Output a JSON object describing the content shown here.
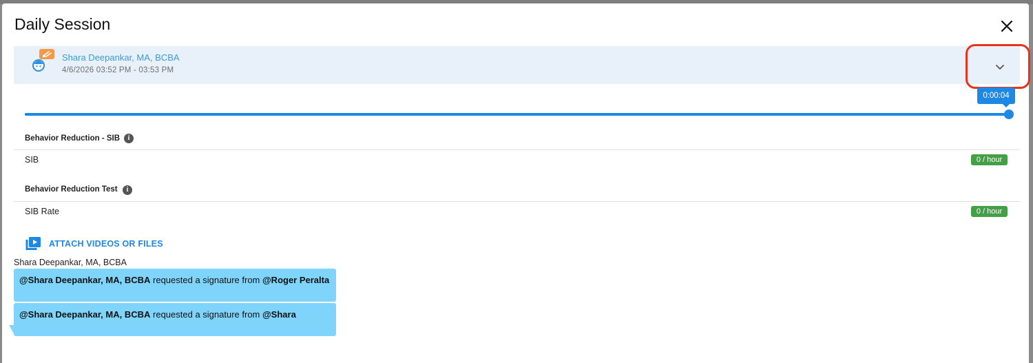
{
  "modal": {
    "title": "Daily Session"
  },
  "session": {
    "clinician": "Shara Deepankar, MA, BCBA",
    "time_range": "4/6/2026 03:52 PM - 03:53 PM"
  },
  "playback": {
    "current_time": "0:00:04",
    "progress": 1.0
  },
  "sections": [
    {
      "title": "Behavior Reduction - SIB",
      "row_label": "SIB",
      "rate": "0 / hour"
    },
    {
      "title": "Behavior Reduction Test",
      "row_label": "SIB Rate",
      "rate": "0 / hour"
    }
  ],
  "attach": {
    "label": "ATTACH VIDEOS OR FILES"
  },
  "comments": {
    "author": "Shara Deepankar, MA, BCBA",
    "messages": [
      {
        "requester": "@Shara Deepankar, MA, BCBA",
        "middle": " requested a signature from ",
        "target": "@Roger Peralta"
      },
      {
        "requester": "@Shara Deepankar, MA, BCBA",
        "middle": " requested a signature from ",
        "target": "@Shara"
      }
    ]
  },
  "colors": {
    "accent": "#1e88e5",
    "link": "#3a9ad9",
    "badge": "#43a047",
    "message_bg": "#7fd4fb",
    "header_bg": "#e8f1fa",
    "highlight": "#e8321c"
  },
  "icons": {
    "close": "close-icon",
    "expand": "chevron-down-icon",
    "info": "info-icon",
    "attach": "video-library-icon",
    "avatar": "child-avatar-icon"
  }
}
